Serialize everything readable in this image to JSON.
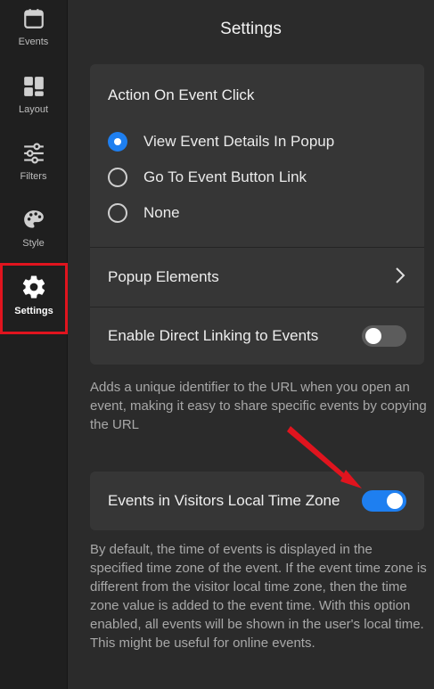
{
  "sidebar": {
    "items": [
      {
        "label": "Events",
        "icon": "calendar-icon"
      },
      {
        "label": "Layout",
        "icon": "layout-icon"
      },
      {
        "label": "Filters",
        "icon": "sliders-icon"
      },
      {
        "label": "Style",
        "icon": "palette-icon"
      },
      {
        "label": "Settings",
        "icon": "gear-icon",
        "active": true
      }
    ]
  },
  "main": {
    "title": "Settings",
    "action_section": {
      "heading": "Action On Event Click",
      "options": [
        {
          "label": "View Event Details In Popup",
          "selected": true
        },
        {
          "label": "Go To Event Button Link",
          "selected": false
        },
        {
          "label": "None",
          "selected": false
        }
      ]
    },
    "popup_elements": {
      "label": "Popup Elements"
    },
    "direct_linking": {
      "label": "Enable Direct Linking to Events",
      "enabled": false,
      "description": "Adds a unique identifier to the URL when you open an event, making it easy to share specific events by copying the URL"
    },
    "local_time_zone": {
      "label": "Events in Visitors Local Time Zone",
      "enabled": true,
      "description": "By default, the time of events is displayed in the specified time zone of the event. If the event time zone is different from the visitor local time zone, then the time zone value is added to the event time. With this option enabled, all events will be shown in the user's local time. This might be useful for online events."
    }
  },
  "colors": {
    "accent": "#1e7ff0",
    "highlight_box": "#e0141e",
    "annotation_arrow": "#e0141e"
  }
}
